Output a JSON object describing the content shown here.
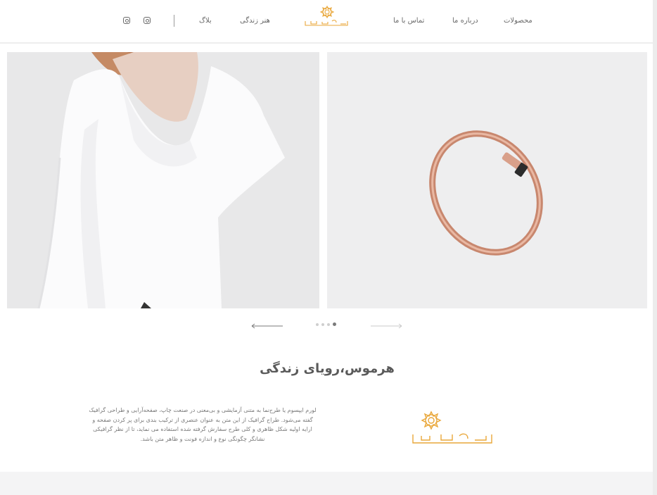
{
  "nav": {
    "products": "محصولات",
    "about": "درباره ما",
    "contact": "تماس با ما",
    "art_of_life": "هنر زندگی",
    "blog": "بلاگ",
    "logo_alt": "هرموس"
  },
  "icons": [
    "instagram-icon",
    "instagram-icon",
    "arrow-left-icon",
    "arrow-right-icon"
  ],
  "slider": {
    "dots_count": 4,
    "active_dot": 4
  },
  "about_section": {
    "title": "هرموس،رویای زندگی",
    "lines": [
      "لورم ایپسوم یا طرح‌نما به متنی آزمایشی و بی‌معنی در صنعت چاپ، صفحه‌آرایی و طراحی گرافیک",
      "گفته می‌شود. طراح گرافیک از این متن به عنوان عنصری از ترکیب بندی برای پر کردن صفحه و",
      "ارایه اولیه شکل ظاهری و کلی طرح سفارش گرفته شده استفاده می نماید، تا از نظر گرافیکی",
      "نشانگر چگونگی نوع و اندازه فونت و ظاهر متن باشد."
    ]
  },
  "colors": {
    "brand_gold": "#e9a73a",
    "text_gray": "#6a6a6a"
  }
}
